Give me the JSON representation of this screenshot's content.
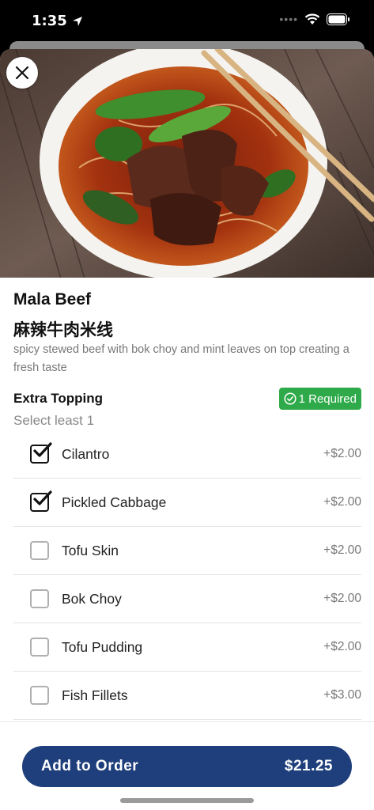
{
  "status_bar": {
    "time": "1:35"
  },
  "item": {
    "name": "Mala Beef",
    "name_cn": "麻辣牛肉米线",
    "description": "spicy stewed beef with bok choy and mint leaves on top creating a fresh taste"
  },
  "topping_section": {
    "title": "Extra Topping",
    "required_label": "1 Required",
    "hint": "Select least 1",
    "options": [
      {
        "label": "Cilantro",
        "price": "+$2.00",
        "checked": true
      },
      {
        "label": "Pickled Cabbage",
        "price": "+$2.00",
        "checked": true
      },
      {
        "label": "Tofu Skin",
        "price": "+$2.00",
        "checked": false
      },
      {
        "label": "Bok Choy",
        "price": "+$2.00",
        "checked": false
      },
      {
        "label": "Tofu Pudding",
        "price": "+$2.00",
        "checked": false
      },
      {
        "label": "Fish Fillets",
        "price": "+$3.00",
        "checked": false
      }
    ]
  },
  "footer": {
    "button_label": "Add to Order",
    "total": "$21.25"
  },
  "colors": {
    "accent": "#1f3f7c",
    "badge": "#2faa4a"
  },
  "icons": {
    "close": "close-icon",
    "check": "check-icon",
    "location": "location-arrow-icon",
    "wifi": "wifi-icon",
    "battery": "battery-icon"
  }
}
